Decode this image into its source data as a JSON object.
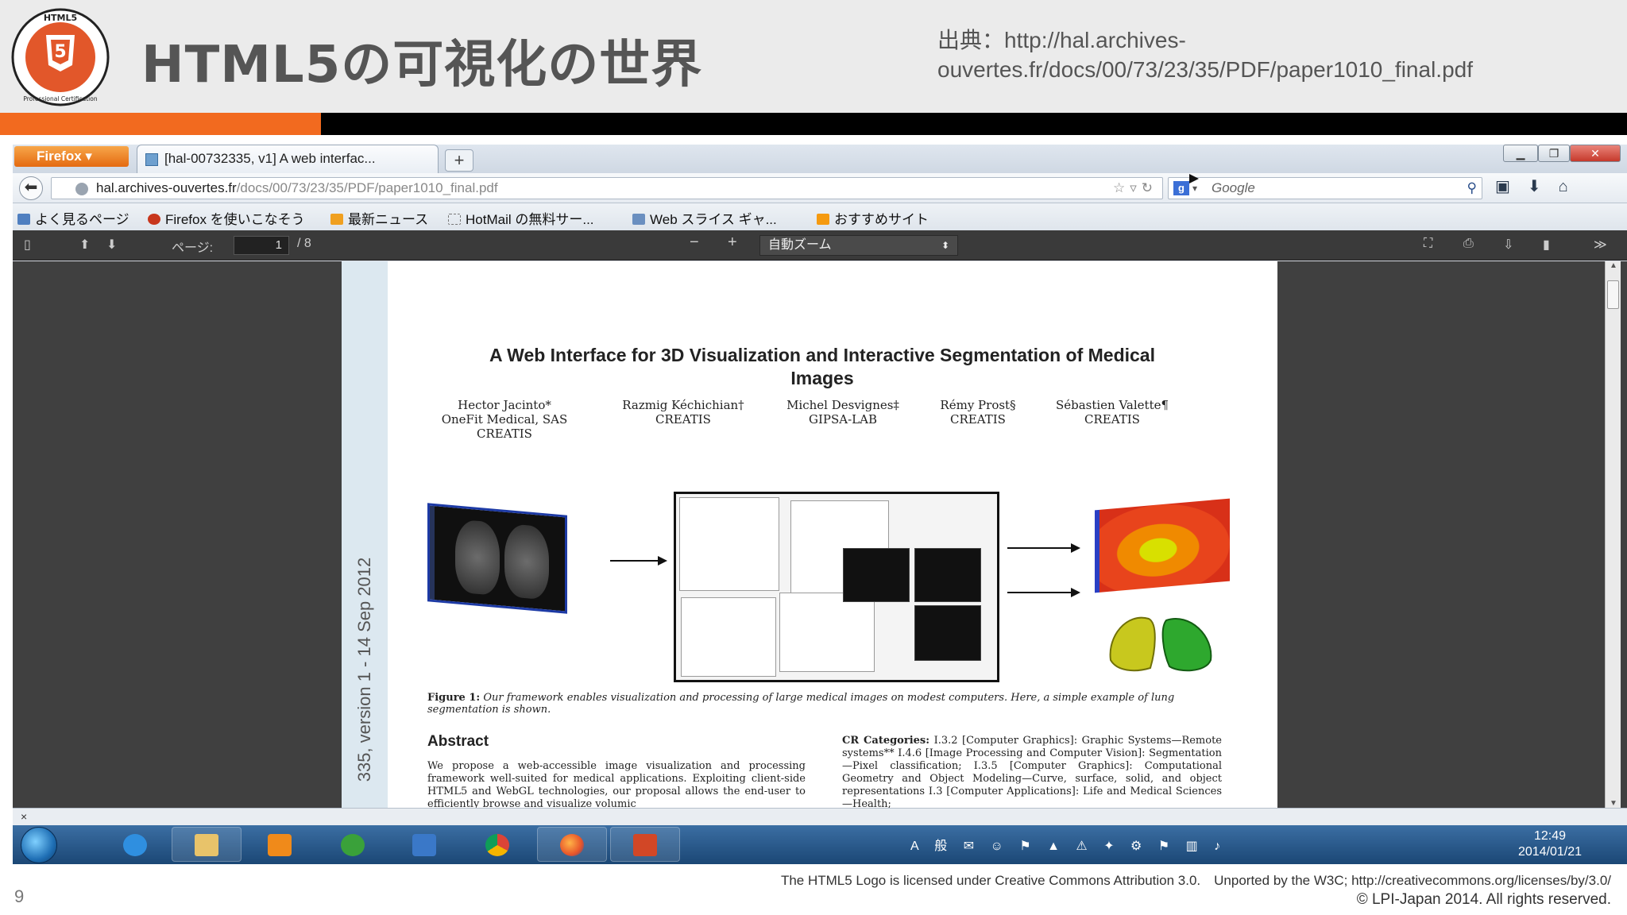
{
  "slide": {
    "title": "HTML5の可視化の世界",
    "source": "出典：http://hal.archives-ouvertes.fr/docs/00/73/23/35/PDF/paper1010_final.pdf",
    "logo_text_top": "HTML5",
    "logo_text_bottom": "Professional Certification",
    "page_number": "9",
    "credit_line": "The HTML5 Logo is licensed under Creative Commons Attribution 3.0.　Unported by the W3C; http://creativecommons.org/licenses/by/3.0/",
    "copyright": "© LPI-Japan 2014. All rights reserved.",
    "colors": {
      "accent": "#f26a1f",
      "header_bg": "#ebebeb",
      "title_text": "#555555"
    }
  },
  "browser": {
    "menu_button": "Firefox",
    "tab_title": "[hal-00732335, v1] A web interfac...",
    "new_tab": "+",
    "url_host": "hal.archives-ouvertes.fr",
    "url_path": "/docs/00/73/23/35/PDF/paper1010_final.pdf",
    "search_engine": "Google",
    "bookmarks": [
      "よく見るページ",
      "Firefox を使いこなそう",
      "最新ニュース",
      "HotMail の無料サー...",
      "Web スライス ギャ...",
      "おすすめサイト"
    ]
  },
  "pdf_toolbar": {
    "page_label": "ページ:",
    "page_current": "1",
    "page_total": "/ 8",
    "zoom_out": "−",
    "zoom_in": "+",
    "zoom_mode": "自動ズーム"
  },
  "paper": {
    "side_stamp": "335, version 1 - 14 Sep 2012",
    "title_line1": "A Web Interface for 3D Visualization and Interactive Segmentation of Medical",
    "title_line2": "Images",
    "authors": [
      {
        "name": "Hector Jacinto*",
        "affiliation": "OneFit Medical, SAS",
        "affiliation2": "CREATIS"
      },
      {
        "name": "Razmig Kéchichian†",
        "affiliation": "CREATIS",
        "affiliation2": ""
      },
      {
        "name": "Michel Desvignes‡",
        "affiliation": "GIPSA-LAB",
        "affiliation2": ""
      },
      {
        "name": "Rémy Prost§",
        "affiliation": "CREATIS",
        "affiliation2": ""
      },
      {
        "name": "Sébastien Valette¶",
        "affiliation": "CREATIS",
        "affiliation2": ""
      }
    ],
    "figure_label": "Figure 1:",
    "figure_caption": "Our framework enables visualization and processing of large medical images on modest computers. Here, a simple example of lung segmentation is shown.",
    "abstract_heading": "Abstract",
    "abstract_text": "We propose a web-accessible image visualization and processing framework well-suited for medical applications. Exploiting client-side HTML5 and WebGL technologies, our proposal allows the end-user to efficiently browse and visualize volumic",
    "cr_label": "CR Categories:",
    "cr_text": "I.3.2 [Computer Graphics]: Graphic Systems—Remote systems** I.4.6 [Image Processing and Computer Vision]: Segmentation—Pixel classification; I.3.5 [Computer Graphics]: Computational Geometry and Object Modeling—Curve, surface, solid, and object representations I.3 [Computer Applications]: Life and Medical Sciences—Health;"
  },
  "findbar": {
    "close": "×"
  },
  "taskbar": {
    "clock_time": "12:49",
    "clock_date": "2014/01/21",
    "apps": [
      "internet-explorer",
      "file-explorer",
      "media-player",
      "network-app",
      "remote-desktop",
      "chrome",
      "firefox",
      "powerpoint"
    ],
    "tray_text": "A 般"
  }
}
